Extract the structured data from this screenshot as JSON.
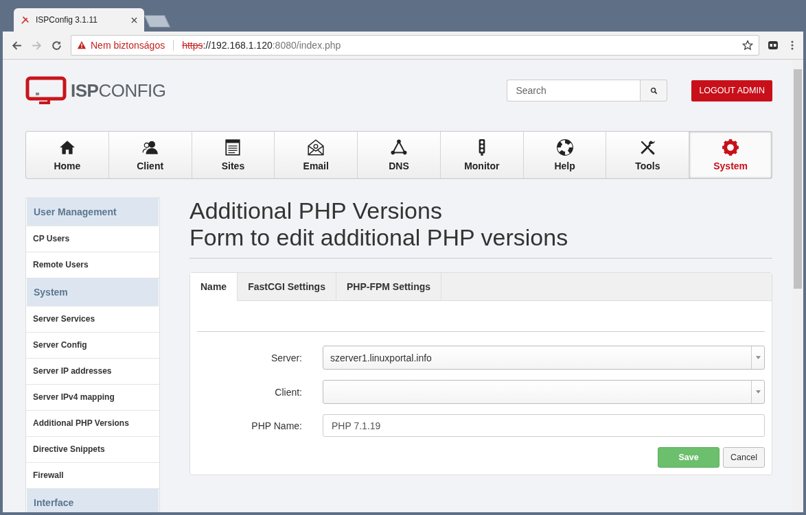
{
  "browser": {
    "tab_title": "ISPConfig 3.1.11",
    "security_warning": "Nem biztonságos",
    "url_scheme": "https",
    "url_host": "://192.168.1.120",
    "url_rest": ":8080/index.php"
  },
  "header": {
    "logo_bold": "ISP",
    "logo_light": "CONFIG",
    "search": {
      "placeholder": "Search"
    },
    "logout": "LOGOUT ADMIN"
  },
  "nav": [
    {
      "label": "Home",
      "selected": false
    },
    {
      "label": "Client",
      "selected": false
    },
    {
      "label": "Sites",
      "selected": false
    },
    {
      "label": "Email",
      "selected": false
    },
    {
      "label": "DNS",
      "selected": false
    },
    {
      "label": "Monitor",
      "selected": false
    },
    {
      "label": "Help",
      "selected": false
    },
    {
      "label": "Tools",
      "selected": false
    },
    {
      "label": "System",
      "selected": true
    }
  ],
  "sidebar": [
    {
      "kind": "header",
      "label": "User Management"
    },
    {
      "kind": "item",
      "label": "CP Users"
    },
    {
      "kind": "item",
      "label": "Remote Users"
    },
    {
      "kind": "header",
      "label": "System"
    },
    {
      "kind": "item",
      "label": "Server Services"
    },
    {
      "kind": "item",
      "label": "Server Config"
    },
    {
      "kind": "item",
      "label": "Server IP addresses"
    },
    {
      "kind": "item",
      "label": "Server IPv4 mapping"
    },
    {
      "kind": "item",
      "label": "Additional PHP Versions"
    },
    {
      "kind": "item",
      "label": "Directive Snippets"
    },
    {
      "kind": "item",
      "label": "Firewall"
    },
    {
      "kind": "header",
      "label": "Interface"
    }
  ],
  "title": [
    "Additional PHP Versions",
    "Form to edit additional PHP versions"
  ],
  "tabs": [
    {
      "label": "Name",
      "selected": true
    },
    {
      "label": "FastCGI Settings",
      "selected": false
    },
    {
      "label": "PHP-FPM Settings",
      "selected": false
    }
  ],
  "fields": [
    {
      "kind": "select",
      "label": "Server:",
      "value": "szerver1.linuxportal.info"
    },
    {
      "kind": "select",
      "label": "Client:"
    },
    {
      "kind": "text",
      "label": "PHP Name:",
      "value": "PHP 7.1.19"
    }
  ],
  "buttons": {
    "save": "Save",
    "cancel": "Cancel"
  }
}
